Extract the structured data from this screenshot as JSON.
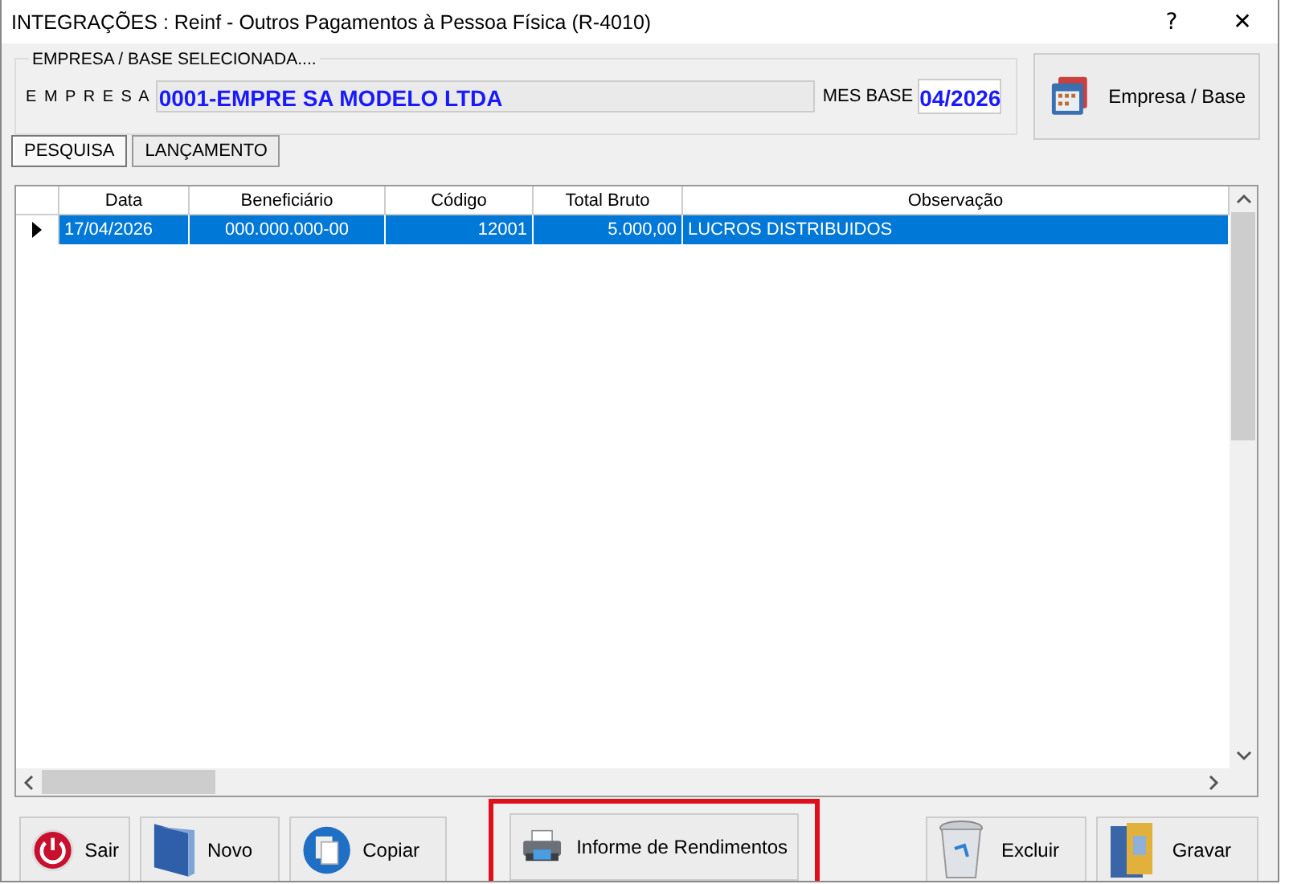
{
  "window": {
    "title": "INTEGRAÇÕES : Reinf - Outros Pagamentos à Pessoa Física (R-4010)",
    "help": "?",
    "close": "✕"
  },
  "selection": {
    "legend": "EMPRESA  /  BASE  SELECIONADA....",
    "empresa_label": "E M P R E S A",
    "empresa_value": "0001-EMPRE SA MODELO LTDA",
    "mes_label": "MES BASE",
    "mes_value": "04/2026",
    "button": "Empresa / Base"
  },
  "tabs": [
    {
      "label": "PESQUISA",
      "selected": true
    },
    {
      "label": "LANÇAMENTO",
      "selected": false
    }
  ],
  "table": {
    "columns": [
      "Data",
      "Beneficiário",
      "Código",
      "Total Bruto",
      "Observação"
    ],
    "rows": [
      {
        "cells": [
          "17/04/2026",
          "000.000.000-00",
          "12001",
          "5.000,00",
          "LUCROS DISTRIBUIDOS"
        ],
        "selected": true
      }
    ]
  },
  "buttons": [
    {
      "label": "Sair",
      "kind": "power",
      "highlighted": false
    },
    {
      "label": "Novo",
      "kind": "folder",
      "highlighted": false
    },
    {
      "label": "Copiar",
      "kind": "copy",
      "highlighted": false
    },
    {
      "label": "Informe de Rendimentos",
      "kind": "printer",
      "highlighted": true
    },
    {
      "label": "Excluir",
      "kind": "trash",
      "highlighted": false
    },
    {
      "label": "Gravar",
      "kind": "save",
      "highlighted": false
    }
  ]
}
